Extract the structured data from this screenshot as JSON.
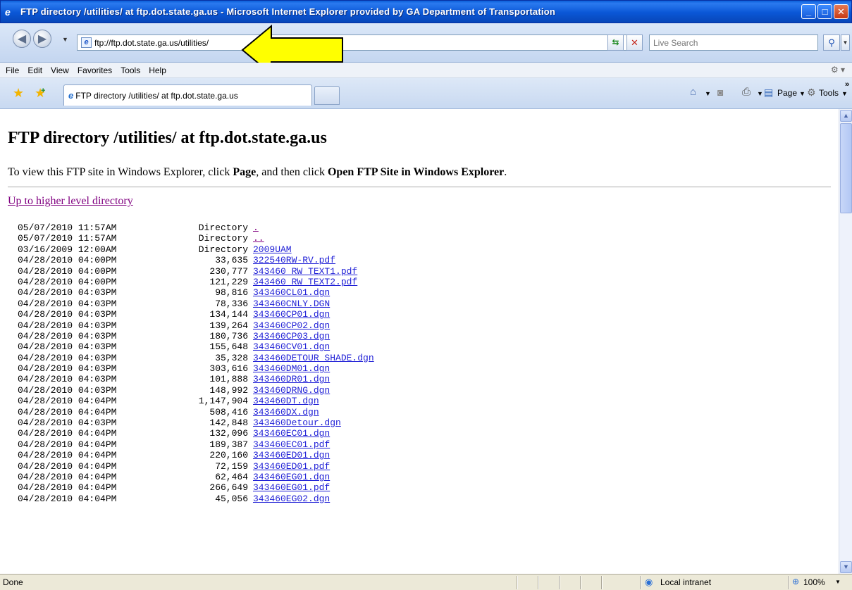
{
  "window": {
    "title": "FTP directory /utilities/ at ftp.dot.state.ga.us - Microsoft Internet Explorer provided by GA Department of Transportation"
  },
  "address": {
    "url": "ftp://ftp.dot.state.ga.us/utilities/",
    "search_placeholder": "Live Search"
  },
  "menu": {
    "items": [
      "File",
      "Edit",
      "View",
      "Favorites",
      "Tools",
      "Help"
    ]
  },
  "tabs": {
    "active_label": "FTP directory /utilities/ at ftp.dot.state.ga.us"
  },
  "commands": {
    "page_label": "Page",
    "tools_label": "Tools"
  },
  "content": {
    "heading": "FTP directory /utilities/ at ftp.dot.state.ga.us",
    "instructions_pre": "To view this FTP site in Windows Explorer, click ",
    "instructions_page": "Page",
    "instructions_mid": ", and then click ",
    "instructions_open": "Open FTP Site in Windows Explorer",
    "instructions_end": ".",
    "up_link": "Up to higher level directory"
  },
  "listing": [
    {
      "date": "05/07/2010 11:57AM",
      "size": "Directory",
      "name": ".",
      "visited": true
    },
    {
      "date": "05/07/2010 11:57AM",
      "size": "Directory",
      "name": "..",
      "visited": true
    },
    {
      "date": "03/16/2009 12:00AM",
      "size": "Directory",
      "name": "2009UAM",
      "visited": false
    },
    {
      "date": "04/28/2010 04:00PM",
      "size": "33,635",
      "name": "322540RW-RV.pdf",
      "visited": false
    },
    {
      "date": "04/28/2010 04:00PM",
      "size": "230,777",
      "name": "343460 RW TEXT1.pdf",
      "visited": false
    },
    {
      "date": "04/28/2010 04:00PM",
      "size": "121,229",
      "name": "343460 RW TEXT2.pdf",
      "visited": false
    },
    {
      "date": "04/28/2010 04:03PM",
      "size": "98,816",
      "name": "343460CL01.dgn",
      "visited": false
    },
    {
      "date": "04/28/2010 04:03PM",
      "size": "78,336",
      "name": "343460CNLY.DGN",
      "visited": false
    },
    {
      "date": "04/28/2010 04:03PM",
      "size": "134,144",
      "name": "343460CP01.dgn",
      "visited": false
    },
    {
      "date": "04/28/2010 04:03PM",
      "size": "139,264",
      "name": "343460CP02.dgn",
      "visited": false
    },
    {
      "date": "04/28/2010 04:03PM",
      "size": "180,736",
      "name": "343460CP03.dgn",
      "visited": false
    },
    {
      "date": "04/28/2010 04:03PM",
      "size": "155,648",
      "name": "343460CV01.dgn",
      "visited": false
    },
    {
      "date": "04/28/2010 04:03PM",
      "size": "35,328",
      "name": "343460DETOUR SHADE.dgn",
      "visited": false
    },
    {
      "date": "04/28/2010 04:03PM",
      "size": "303,616",
      "name": "343460DM01.dgn",
      "visited": false
    },
    {
      "date": "04/28/2010 04:03PM",
      "size": "101,888",
      "name": "343460DR01.dgn",
      "visited": false
    },
    {
      "date": "04/28/2010 04:03PM",
      "size": "148,992",
      "name": "343460DRNG.dgn",
      "visited": false
    },
    {
      "date": "04/28/2010 04:04PM",
      "size": "1,147,904",
      "name": "343460DT.dgn",
      "visited": false
    },
    {
      "date": "04/28/2010 04:04PM",
      "size": "508,416",
      "name": "343460DX.dgn",
      "visited": false
    },
    {
      "date": "04/28/2010 04:03PM",
      "size": "142,848",
      "name": "343460Detour.dgn",
      "visited": false
    },
    {
      "date": "04/28/2010 04:04PM",
      "size": "132,096",
      "name": "343460EC01.dgn",
      "visited": false
    },
    {
      "date": "04/28/2010 04:04PM",
      "size": "189,387",
      "name": "343460EC01.pdf",
      "visited": false
    },
    {
      "date": "04/28/2010 04:04PM",
      "size": "220,160",
      "name": "343460ED01.dgn",
      "visited": false
    },
    {
      "date": "04/28/2010 04:04PM",
      "size": "72,159",
      "name": "343460ED01.pdf",
      "visited": false
    },
    {
      "date": "04/28/2010 04:04PM",
      "size": "62,464",
      "name": "343460EG01.dgn",
      "visited": false
    },
    {
      "date": "04/28/2010 04:04PM",
      "size": "266,649",
      "name": "343460EG01.pdf",
      "visited": false
    },
    {
      "date": "04/28/2010 04:04PM",
      "size": "45,056",
      "name": "343460EG02.dgn",
      "visited": false
    }
  ],
  "status": {
    "text": "Done",
    "zone": "Local intranet",
    "zoom": "100%"
  }
}
